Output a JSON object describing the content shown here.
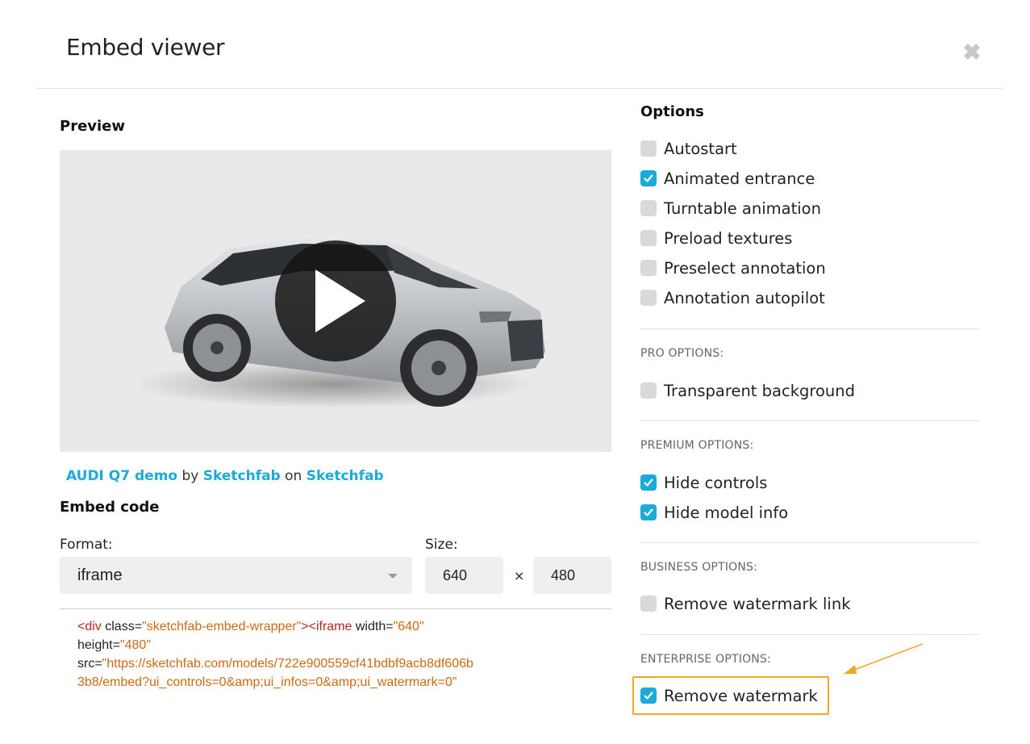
{
  "dialog": {
    "title": "Embed viewer"
  },
  "preview": {
    "heading": "Preview"
  },
  "credit": {
    "model": "AUDI Q7 demo",
    "by": "by",
    "author": "Sketchfab",
    "on": "on",
    "site": "Sketchfab"
  },
  "embed": {
    "heading": "Embed code",
    "format_label": "Format:",
    "format_value": "iframe",
    "size_label": "Size:",
    "width": "640",
    "times": "×",
    "height": "480",
    "code": {
      "p1": "<div",
      "p2": " class=",
      "p3": "\"sketchfab-embed-wrapper\"",
      "p4": "><iframe",
      "p5": " width=",
      "p6": "\"640\"",
      "p7": "height=",
      "p8": "\"480\"",
      "p9": "src=",
      "p10": "\"https://sketchfab.com/models/722e900559cf41bdbf9acb8df606b",
      "p11": "3b8/embed?ui_controls=0&amp;ui_infos=0&amp;ui_watermark=0\""
    }
  },
  "options": {
    "heading": "Options",
    "basic": [
      {
        "label": "Autostart",
        "checked": false
      },
      {
        "label": "Animated entrance",
        "checked": true
      },
      {
        "label": "Turntable animation",
        "checked": false
      },
      {
        "label": "Preload textures",
        "checked": false
      },
      {
        "label": "Preselect annotation",
        "checked": false
      },
      {
        "label": "Annotation autopilot",
        "checked": false
      }
    ],
    "pro_heading": "PRO OPTIONS:",
    "pro": [
      {
        "label": "Transparent background",
        "checked": false
      }
    ],
    "premium_heading": "PREMIUM OPTIONS:",
    "premium": [
      {
        "label": "Hide controls",
        "checked": true
      },
      {
        "label": "Hide model info",
        "checked": true
      }
    ],
    "business_heading": "BUSINESS OPTIONS:",
    "business": [
      {
        "label": "Remove watermark link",
        "checked": false
      }
    ],
    "enterprise_heading": "ENTERPRISE OPTIONS:",
    "enterprise": [
      {
        "label": "Remove watermark",
        "checked": true
      }
    ]
  },
  "colors": {
    "accent": "#1caad9",
    "highlight": "#f5a623"
  }
}
